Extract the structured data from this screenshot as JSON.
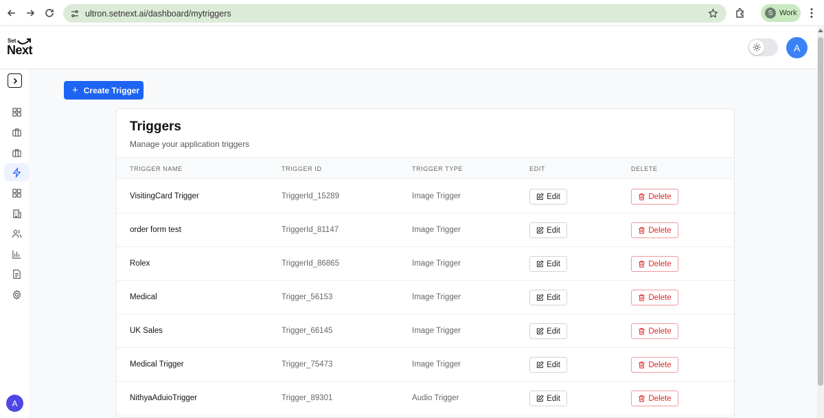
{
  "browser": {
    "url": "ultron.setnext.ai/dashboard/mytriggers",
    "profile_initial": "S",
    "profile_label": "Work"
  },
  "header": {
    "logo_small": "Set",
    "logo_big": "Next",
    "avatar_initial": "A"
  },
  "sidebar": {
    "items": [
      {
        "icon": "grid-icon"
      },
      {
        "icon": "briefcase-icon"
      },
      {
        "icon": "briefcase-icon"
      },
      {
        "icon": "lightning-icon",
        "active": true
      },
      {
        "icon": "grid-icon"
      },
      {
        "icon": "building-icon"
      },
      {
        "icon": "users-icon"
      },
      {
        "icon": "bar-chart-icon"
      },
      {
        "icon": "document-icon"
      },
      {
        "icon": "gear-icon"
      }
    ],
    "avatar_initial": "A"
  },
  "main": {
    "create_button": "Create Trigger",
    "card_title": "Triggers",
    "card_subtitle": "Manage your application triggers",
    "columns": [
      "TRIGGER NAME",
      "TRIGGER ID",
      "TRIGGER TYPE",
      "EDIT",
      "DELETE"
    ],
    "edit_label": "Edit",
    "delete_label": "Delete",
    "rows": [
      {
        "name": "VisitingCard Trigger",
        "id": "TriggerId_15289",
        "type": "Image Trigger"
      },
      {
        "name": "order form test",
        "id": "TriggerId_81147",
        "type": "Image Trigger"
      },
      {
        "name": "Rolex",
        "id": "TriggerId_86865",
        "type": "Image Trigger"
      },
      {
        "name": "Medical",
        "id": "Trigger_56153",
        "type": "Image Trigger"
      },
      {
        "name": "UK Sales",
        "id": "Trigger_66145",
        "type": "Image Trigger"
      },
      {
        "name": "Medical Trigger",
        "id": "Trigger_75473",
        "type": "Image Trigger"
      },
      {
        "name": "NithyaAduioTrigger",
        "id": "Trigger_89301",
        "type": "Audio Trigger"
      }
    ]
  },
  "colors": {
    "primary": "#1d64f2",
    "danger": "#dc2626",
    "active_bg": "#eef2ff"
  }
}
